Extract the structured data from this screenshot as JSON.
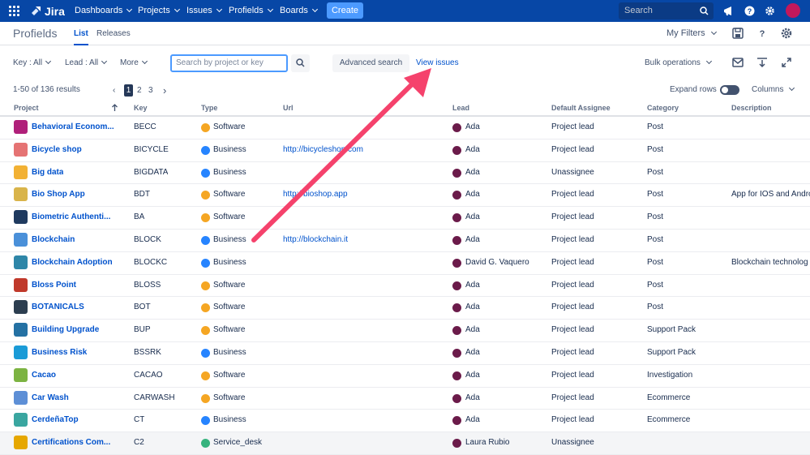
{
  "topnav": {
    "logo": "Jira",
    "items": [
      "Dashboards",
      "Projects",
      "Issues",
      "Profields",
      "Boards"
    ],
    "create_label": "Create",
    "search_placeholder": "Search"
  },
  "subheader": {
    "title": "Profields",
    "tabs": [
      "List",
      "Releases"
    ],
    "my_filters": "My Filters"
  },
  "filters": {
    "key": "Key : All",
    "lead": "Lead : All",
    "more": "More",
    "search_placeholder": "Search by project or key",
    "advanced_search": "Advanced search",
    "view_issues": "View issues",
    "bulk_operations": "Bulk operations"
  },
  "pagination": {
    "results": "1-50 of 136 results",
    "pages": [
      "1",
      "2",
      "3"
    ],
    "expand_rows": "Expand rows",
    "columns": "Columns"
  },
  "table": {
    "headers": [
      "Project",
      "Key",
      "Type",
      "Url",
      "Lead",
      "Default Assignee",
      "Category",
      "Description"
    ],
    "rows": [
      {
        "project": "Behavioral Econom...",
        "key": "BECC",
        "type": "Software",
        "url": "",
        "lead": "Ada",
        "assignee": "Project lead",
        "category": "Post",
        "description": "",
        "icon_color": "#b0207a"
      },
      {
        "project": "Bicycle shop",
        "key": "BICYCLE",
        "type": "Business",
        "url": "http://bicycleshop.com",
        "lead": "Ada",
        "assignee": "Project lead",
        "category": "Post",
        "description": "",
        "icon_color": "#e57373"
      },
      {
        "project": "Big data",
        "key": "BIGDATA",
        "type": "Business",
        "url": "",
        "lead": "Ada",
        "assignee": "Unassignee",
        "category": "Post",
        "description": "",
        "icon_color": "#f2b134"
      },
      {
        "project": "Bio Shop App",
        "key": "BDT",
        "type": "Software",
        "url": "http://bioshop.app",
        "lead": "Ada",
        "assignee": "Project lead",
        "category": "Post",
        "description": "App for IOS and Andro",
        "icon_color": "#d9b44a"
      },
      {
        "project": "Biometric Authenti...",
        "key": "BA",
        "type": "Software",
        "url": "",
        "lead": "Ada",
        "assignee": "Project lead",
        "category": "Post",
        "description": "",
        "icon_color": "#1f3a5f"
      },
      {
        "project": "Blockchain",
        "key": "BLOCK",
        "type": "Business",
        "url": "http://blockchain.it",
        "lead": "Ada",
        "assignee": "Project lead",
        "category": "Post",
        "description": "",
        "icon_color": "#4a90d9"
      },
      {
        "project": "Blockchain Adoption",
        "key": "BLOCKC",
        "type": "Business",
        "url": "",
        "lead": "David G. Vaquero",
        "assignee": "Project lead",
        "category": "Post",
        "description": "Blockchain technolog",
        "icon_color": "#2e86a8"
      },
      {
        "project": "Bloss Point",
        "key": "BLOSS",
        "type": "Software",
        "url": "",
        "lead": "Ada",
        "assignee": "Project lead",
        "category": "Post",
        "description": "",
        "icon_color": "#c0392b"
      },
      {
        "project": "BOTANICALS",
        "key": "BOT",
        "type": "Software",
        "url": "",
        "lead": "Ada",
        "assignee": "Project lead",
        "category": "Post",
        "description": "",
        "icon_color": "#2c3e50"
      },
      {
        "project": "Building Upgrade",
        "key": "BUP",
        "type": "Software",
        "url": "",
        "lead": "Ada",
        "assignee": "Project lead",
        "category": "Support Pack",
        "description": "",
        "icon_color": "#2471a3"
      },
      {
        "project": "Business Risk",
        "key": "BSSRK",
        "type": "Business",
        "url": "",
        "lead": "Ada",
        "assignee": "Project lead",
        "category": "Support Pack",
        "description": "",
        "icon_color": "#1a9bd7"
      },
      {
        "project": "Cacao",
        "key": "CACAO",
        "type": "Software",
        "url": "",
        "lead": "Ada",
        "assignee": "Project lead",
        "category": "Investigation",
        "description": "",
        "icon_color": "#7cb342"
      },
      {
        "project": "Car Wash",
        "key": "CARWASH",
        "type": "Software",
        "url": "",
        "lead": "Ada",
        "assignee": "Project lead",
        "category": "Ecommerce",
        "description": "",
        "icon_color": "#5d8fd6"
      },
      {
        "project": "CerdeñaTop",
        "key": "CT",
        "type": "Business",
        "url": "",
        "lead": "Ada",
        "assignee": "Project lead",
        "category": "Ecommerce",
        "description": "",
        "icon_color": "#3aa6a0"
      },
      {
        "project": "Certifications Com...",
        "key": "C2",
        "type": "Service_desk",
        "url": "",
        "lead": "Laura Rubio",
        "assignee": "Unassignee",
        "category": "",
        "description": "",
        "icon_color": "#e6a700"
      }
    ]
  },
  "colors": {
    "nav_bg": "#0747a6",
    "link": "#0052cc",
    "software": "#f5a623",
    "business": "#2684ff",
    "service_desk": "#36b37e",
    "arrow": "#f5426c"
  }
}
